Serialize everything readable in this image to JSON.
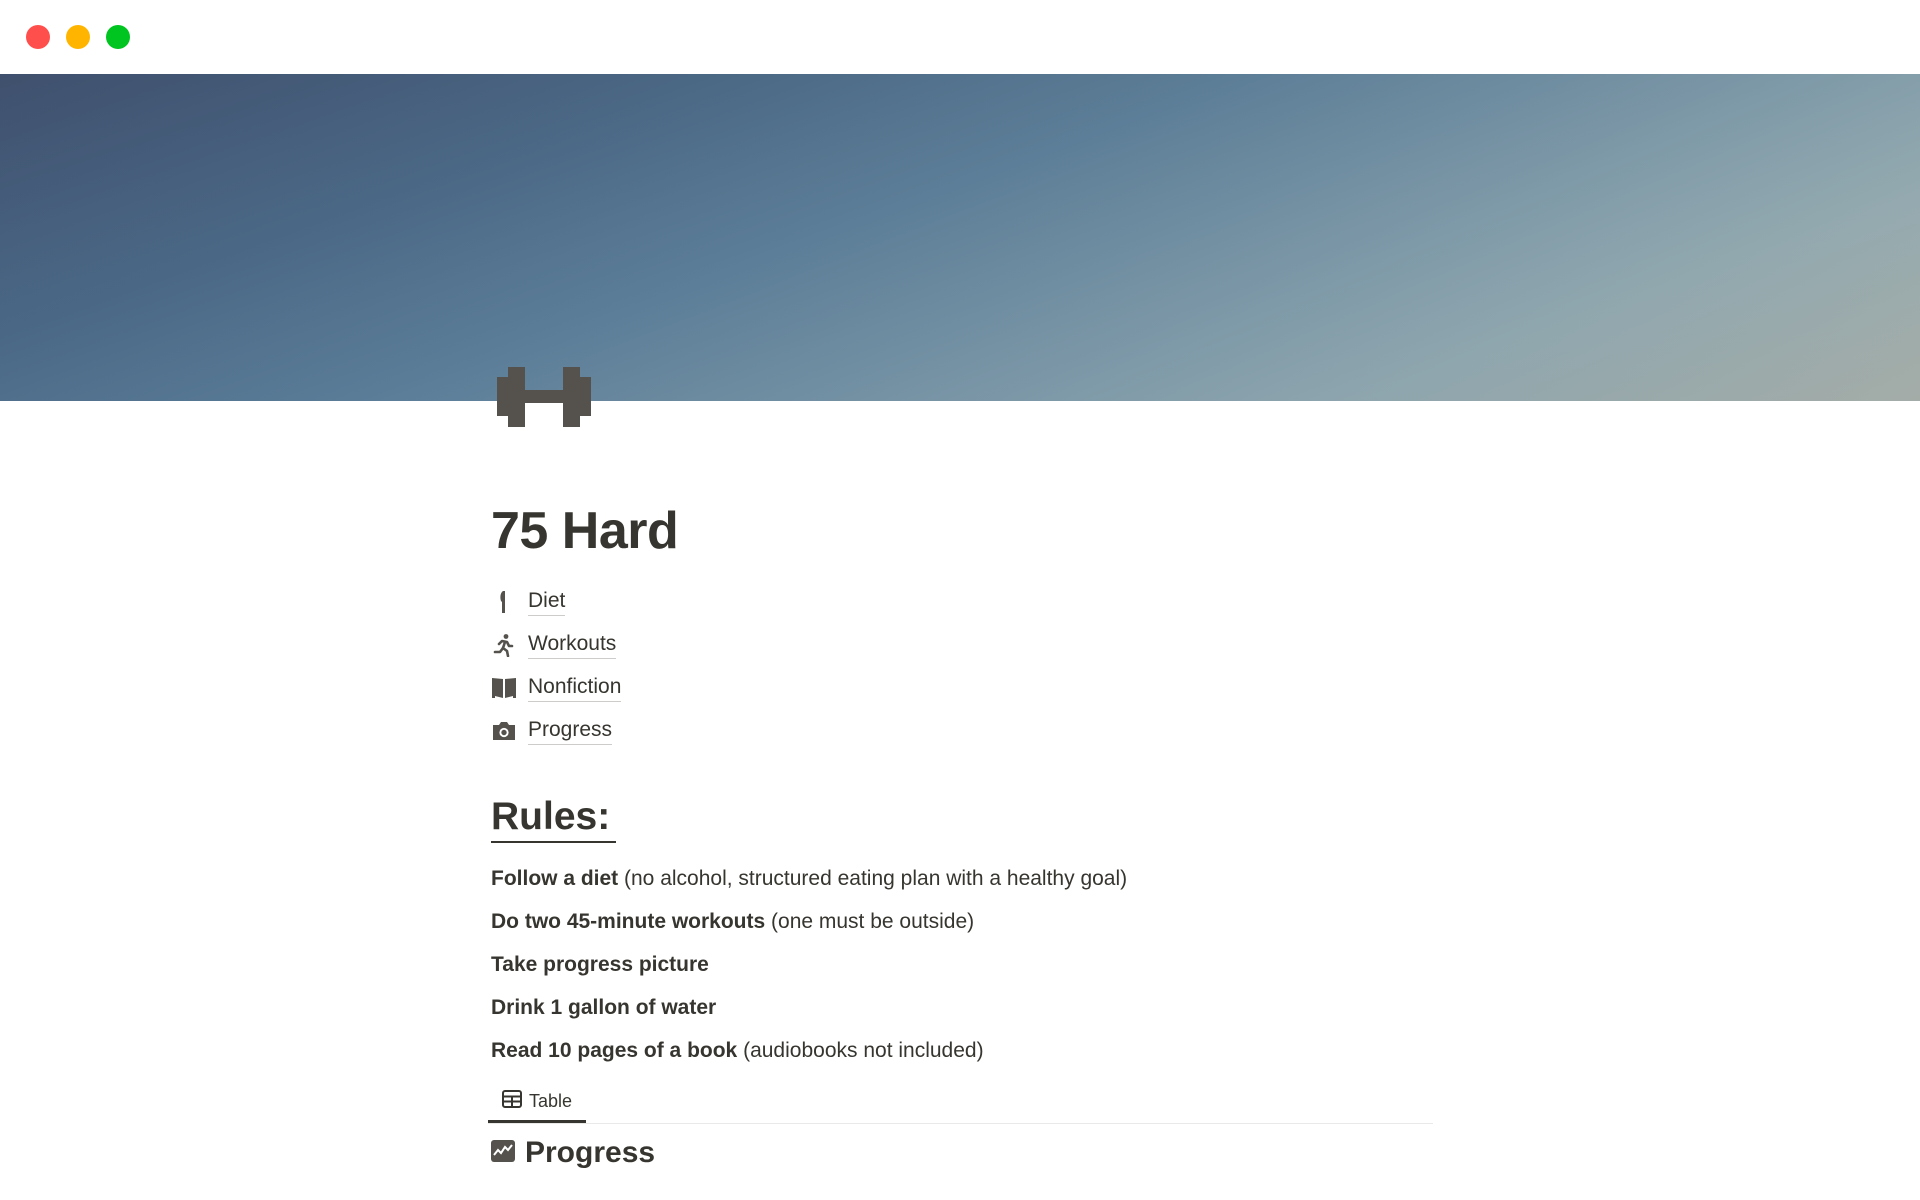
{
  "window": {
    "controls": [
      "close",
      "minimize",
      "maximize"
    ],
    "colors": {
      "close": "#ff4f4d",
      "minimize": "#ffb500",
      "maximize": "#00c41f"
    }
  },
  "cover": {
    "colors": {
      "top_left": "#3f506d",
      "bottom_left": "#3f5f86",
      "top_right": "#b1b5aa",
      "bottom_right": "#a6bcc0"
    }
  },
  "page": {
    "icon": "dumbbell-icon",
    "title": "75 Hard"
  },
  "links": [
    {
      "icon": "fork-knife-icon",
      "label": "Diet"
    },
    {
      "icon": "running-person-icon",
      "label": "Workouts"
    },
    {
      "icon": "open-book-icon",
      "label": "Nonfiction"
    },
    {
      "icon": "camera-icon",
      "label": "Progress"
    }
  ],
  "rules": {
    "heading": "Rules:",
    "items": [
      {
        "bold": "Follow a diet",
        "rest": " (no alcohol, structured eating plan with a healthy goal)"
      },
      {
        "bold": "Do two 45-minute workouts",
        "rest": " (one must be outside)"
      },
      {
        "bold": "Take progress picture",
        "rest": ""
      },
      {
        "bold": "Drink 1 gallon of water",
        "rest": ""
      },
      {
        "bold": "Read 10 pages of a book",
        "rest": " (audiobooks not included)"
      }
    ]
  },
  "database": {
    "views": [
      {
        "icon": "table-icon",
        "label": "Table",
        "active": true
      }
    ],
    "icon": "chart-icon",
    "title": "Progress"
  }
}
